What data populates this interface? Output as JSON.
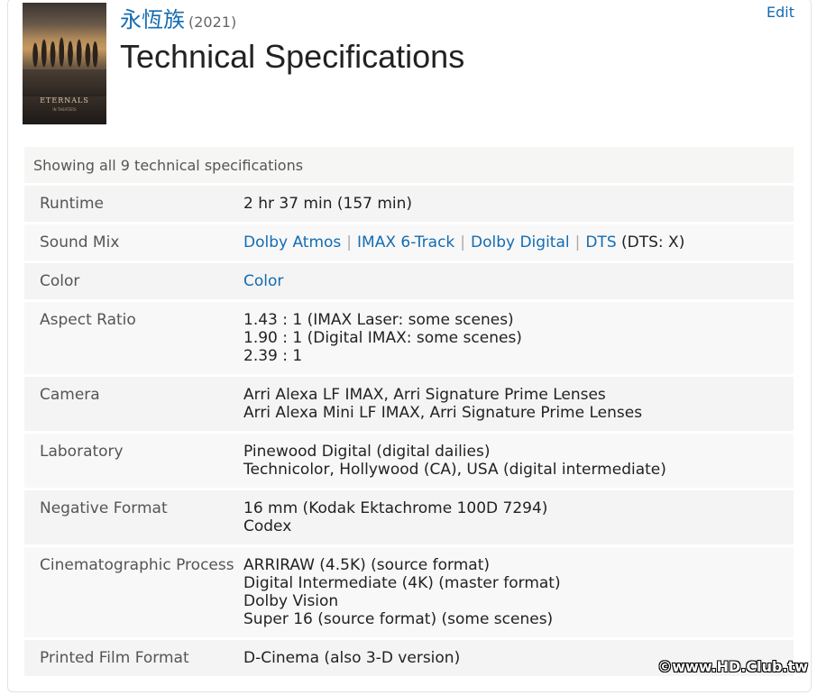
{
  "header": {
    "title_zh": "永恆族",
    "year": "(2021)",
    "page_title": "Technical Specifications",
    "edit_label": "Edit",
    "poster_title": "ETERNALS",
    "poster_tagline": "IN THEATERS"
  },
  "summary": "Showing all 9 technical specifications",
  "specs": {
    "runtime": {
      "label": "Runtime",
      "value": "2 hr 37 min (157 min)"
    },
    "sound_mix": {
      "label": "Sound Mix",
      "links": [
        "Dolby Atmos",
        "IMAX 6-Track",
        "Dolby Digital",
        "DTS"
      ],
      "suffix": "(DTS: X)"
    },
    "color": {
      "label": "Color",
      "link": "Color"
    },
    "aspect_ratio": {
      "label": "Aspect Ratio",
      "lines": [
        "1.43 : 1 (IMAX Laser: some scenes)",
        "1.90 : 1 (Digital IMAX: some scenes)",
        "2.39 : 1"
      ]
    },
    "camera": {
      "label": "Camera",
      "lines": [
        "Arri Alexa LF IMAX, Arri Signature Prime Lenses",
        "Arri Alexa Mini LF IMAX, Arri Signature Prime Lenses"
      ]
    },
    "laboratory": {
      "label": "Laboratory",
      "lines": [
        "Pinewood Digital (digital dailies)",
        "Technicolor, Hollywood (CA), USA (digital intermediate)"
      ]
    },
    "negative_format": {
      "label": "Negative Format",
      "lines": [
        "16 mm (Kodak Ektachrome 100D 7294)",
        "Codex"
      ]
    },
    "cinematographic_process": {
      "label": "Cinematographic Process",
      "lines": [
        "ARRIRAW (4.5K) (source format)",
        "Digital Intermediate (4K) (master format)",
        "Dolby Vision",
        "Super 16 (source format) (some scenes)"
      ]
    },
    "printed_film_format": {
      "label": "Printed Film Format",
      "value": "D-Cinema (also 3-D version)"
    }
  },
  "watermark": "©www.HD.Club.tw",
  "colors": {
    "link": "#136cb2",
    "row_bg": "#f4f4f4",
    "text": "#222222"
  }
}
